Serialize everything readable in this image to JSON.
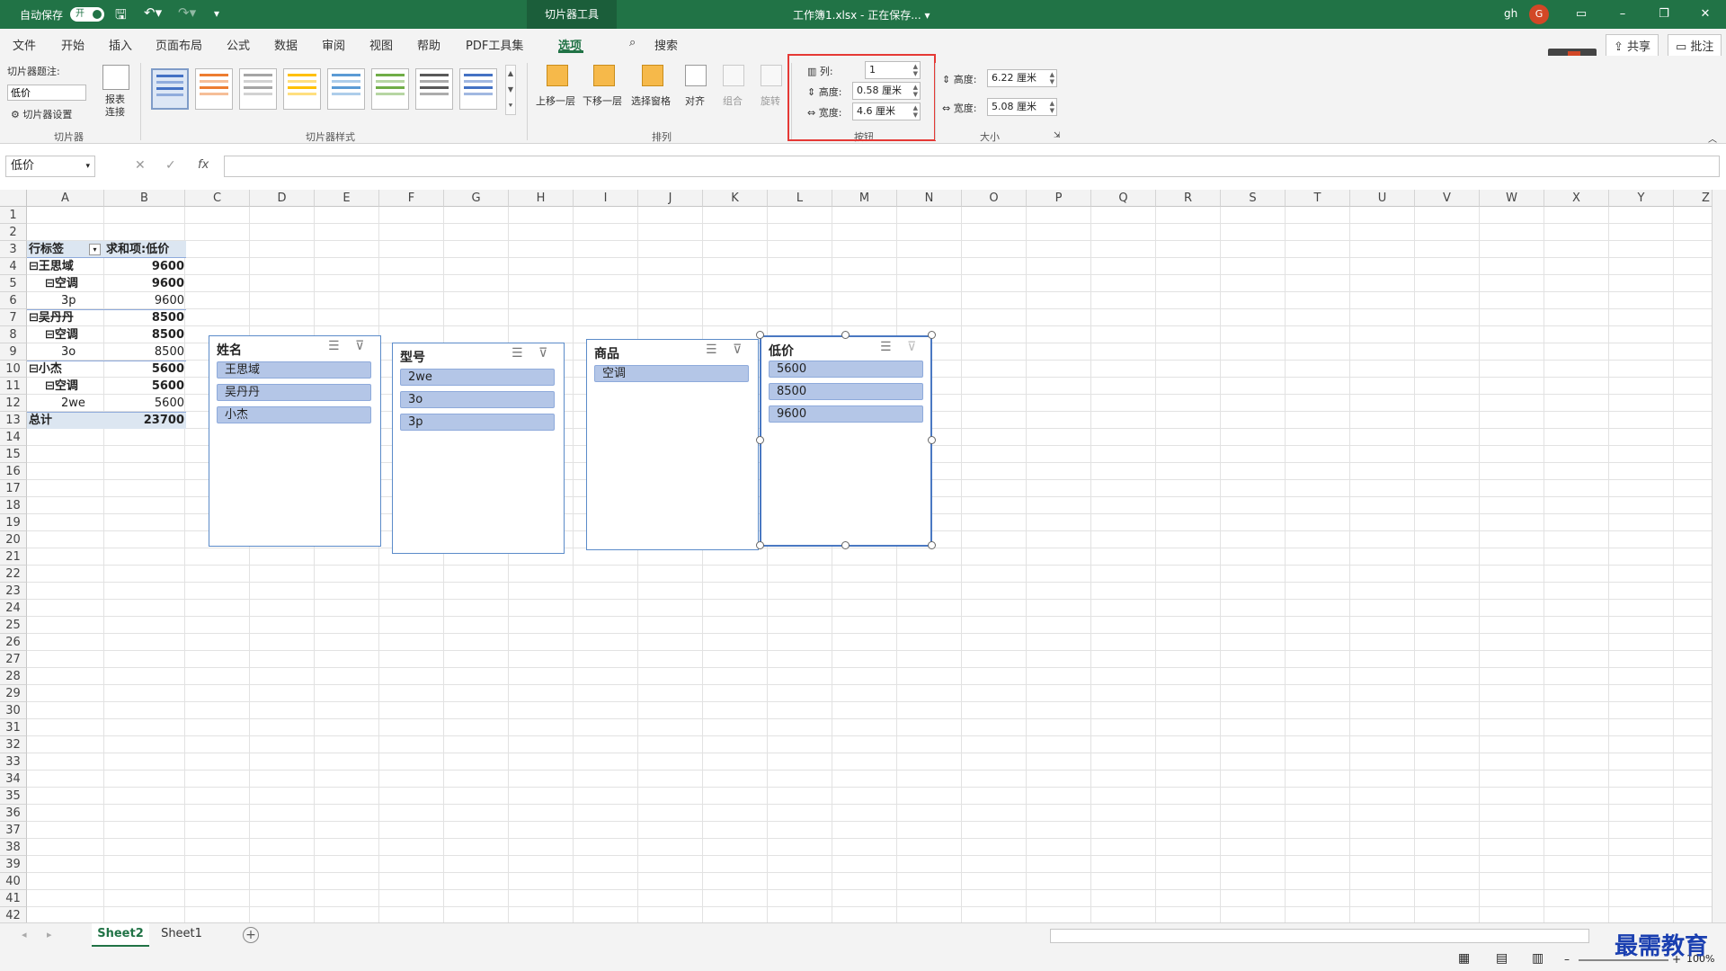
{
  "titlebar": {
    "autosave": "自动保存",
    "toggle": "开",
    "context_tab": "切片器工具",
    "title": "工作簿1.xlsx - 正在保存... ▾",
    "user": "gh",
    "avatar": "G"
  },
  "menu": {
    "tabs": [
      "文件",
      "开始",
      "插入",
      "页面布局",
      "公式",
      "数据",
      "审阅",
      "视图",
      "帮助",
      "PDF工具集",
      "选项"
    ],
    "active": "选项",
    "search": "搜索",
    "share": "共享",
    "comments": "批注"
  },
  "ribbon": {
    "slicer": {
      "caption_label": "切片器题注:",
      "caption_value": "低价",
      "settings": "切片器设置",
      "report": "报表\n连接",
      "group": "切片器"
    },
    "styles": {
      "group": "切片器样式",
      "colors": [
        "#4472c4",
        "#ed7d31",
        "#a5a5a5",
        "#ffc000",
        "#5b9bd5",
        "#70ad47",
        "#595959",
        "#4472c4"
      ]
    },
    "arrange": {
      "bring_forward": "上移一层",
      "send_backward": "下移一层",
      "selection_pane": "选择窗格",
      "align": "对齐",
      "group_btn": "组合",
      "rotate": "旋转",
      "group": "排列"
    },
    "buttons": {
      "columns_label": "列:",
      "columns_value": "1",
      "height_label": "高度:",
      "height_value": "0.58 厘米",
      "width_label": "宽度:",
      "width_value": "4.6 厘米",
      "group": "按钮"
    },
    "size": {
      "height_label": "高度:",
      "height_value": "6.22 厘米",
      "width_label": "宽度:",
      "width_value": "5.08 厘米",
      "group": "大小"
    }
  },
  "formula": {
    "namebox": "低价",
    "fx": "fx"
  },
  "columns": [
    "A",
    "B",
    "C",
    "D",
    "E",
    "F",
    "G",
    "H",
    "I",
    "J",
    "K",
    "L",
    "M",
    "N",
    "O",
    "P",
    "Q",
    "R",
    "S",
    "T",
    "U",
    "V",
    "W",
    "X",
    "Y",
    "Z"
  ],
  "rows": [
    "1",
    "2",
    "3",
    "4",
    "5",
    "6",
    "7",
    "8",
    "9",
    "10",
    "11",
    "12",
    "13",
    "14",
    "15",
    "16",
    "17",
    "18",
    "19",
    "20",
    "21",
    "22",
    "23",
    "24",
    "25",
    "26",
    "27",
    "28",
    "29",
    "30",
    "31",
    "32",
    "33",
    "34",
    "35",
    "36",
    "37",
    "38",
    "39",
    "40",
    "41",
    "42"
  ],
  "pivot": {
    "header": [
      "行标签",
      "求和项:低价"
    ],
    "rows": [
      {
        "label": "⊟王思域",
        "value": "9600",
        "indent": 0,
        "bold": true
      },
      {
        "label": "⊟空调",
        "value": "9600",
        "indent": 1,
        "bold": true
      },
      {
        "label": "3p",
        "value": "9600",
        "indent": 2,
        "bold": false
      },
      {
        "label": "⊟吴丹丹",
        "value": "8500",
        "indent": 0,
        "bold": true
      },
      {
        "label": "⊟空调",
        "value": "8500",
        "indent": 1,
        "bold": true
      },
      {
        "label": "3o",
        "value": "8500",
        "indent": 2,
        "bold": false
      },
      {
        "label": "⊟小杰",
        "value": "5600",
        "indent": 0,
        "bold": true
      },
      {
        "label": "⊟空调",
        "value": "5600",
        "indent": 1,
        "bold": true
      },
      {
        "label": "2we",
        "value": "5600",
        "indent": 2,
        "bold": false
      }
    ],
    "total": [
      "总计",
      "23700"
    ]
  },
  "slicers": [
    {
      "title": "姓名",
      "items": [
        "王思域",
        "吴丹丹",
        "小杰"
      ]
    },
    {
      "title": "型号",
      "items": [
        "2we",
        "3o",
        "3p"
      ]
    },
    {
      "title": "商品",
      "items": [
        "空调"
      ]
    },
    {
      "title": "低价",
      "items": [
        "5600",
        "8500",
        "9600"
      ]
    }
  ],
  "sheets": {
    "tabs": [
      "Sheet2",
      "Sheet1"
    ],
    "active": "Sheet2"
  },
  "status": {
    "zoom": "100%"
  },
  "watermark": "最需教育"
}
